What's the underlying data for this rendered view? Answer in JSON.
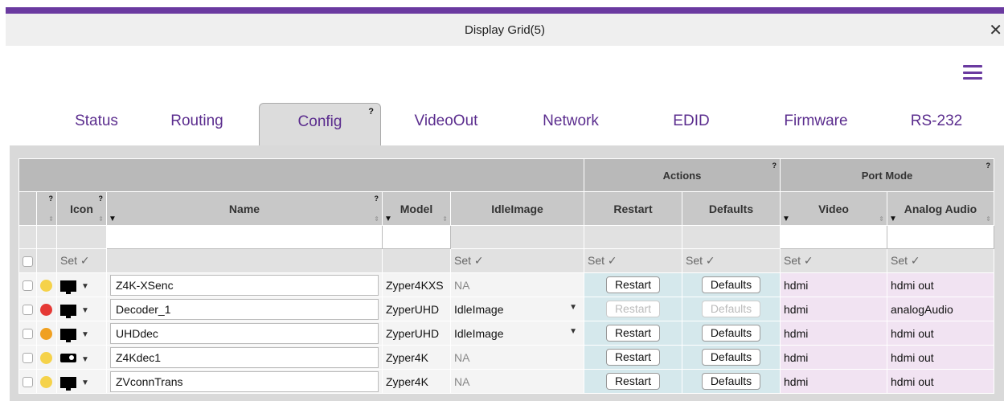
{
  "window": {
    "title": "Display Grid(5)",
    "close_glyph": "✕",
    "menu_icon": "hamburger-icon"
  },
  "tabs": [
    {
      "label": "Status"
    },
    {
      "label": "Routing"
    },
    {
      "label": "Config",
      "active": true,
      "help": "?"
    },
    {
      "label": "VideoOut"
    },
    {
      "label": "Network"
    },
    {
      "label": "EDID"
    },
    {
      "label": "Firmware"
    },
    {
      "label": "RS-232"
    }
  ],
  "table": {
    "groups": {
      "actions": "Actions",
      "port_mode": "Port Mode",
      "help": "?"
    },
    "headers": {
      "icon": "Icon",
      "name": "Name",
      "model": "Model",
      "idle": "IdleImage",
      "restart": "Restart",
      "defaults": "Defaults",
      "video": "Video",
      "audio": "Analog Audio"
    },
    "help": "?",
    "set_label": "Set",
    "check": "✓",
    "restart_label": "Restart",
    "defaults_label": "Defaults",
    "rows": [
      {
        "status": "#f5d24a",
        "icon": "monitor-icon",
        "name": "Z4K-XSenc",
        "model": "Zyper4KXS",
        "idle": "NA",
        "idle_dd": false,
        "disabled": false,
        "video": "hdmi",
        "audio": "hdmi out"
      },
      {
        "status": "#e53935",
        "icon": "monitor-icon",
        "name": "Decoder_1",
        "model": "ZyperUHD",
        "idle": "IdleImage",
        "idle_dd": true,
        "disabled": true,
        "video": "hdmi",
        "audio": "analogAudio"
      },
      {
        "status": "#f0a020",
        "icon": "monitor-icon",
        "name": "UHDdec",
        "model": "ZyperUHD",
        "idle": "IdleImage",
        "idle_dd": true,
        "disabled": false,
        "video": "hdmi",
        "audio": "hdmi out"
      },
      {
        "status": "#f5d24a",
        "icon": "projector-icon",
        "name": "Z4Kdec1",
        "model": "Zyper4K",
        "idle": "NA",
        "idle_dd": false,
        "disabled": false,
        "video": "hdmi",
        "audio": "hdmi out"
      },
      {
        "status": "#f5d24a",
        "icon": "monitor-icon",
        "name": "ZVconnTrans",
        "model": "Zyper4K",
        "idle": "NA",
        "idle_dd": false,
        "disabled": false,
        "video": "hdmi",
        "audio": "hdmi out"
      }
    ]
  }
}
